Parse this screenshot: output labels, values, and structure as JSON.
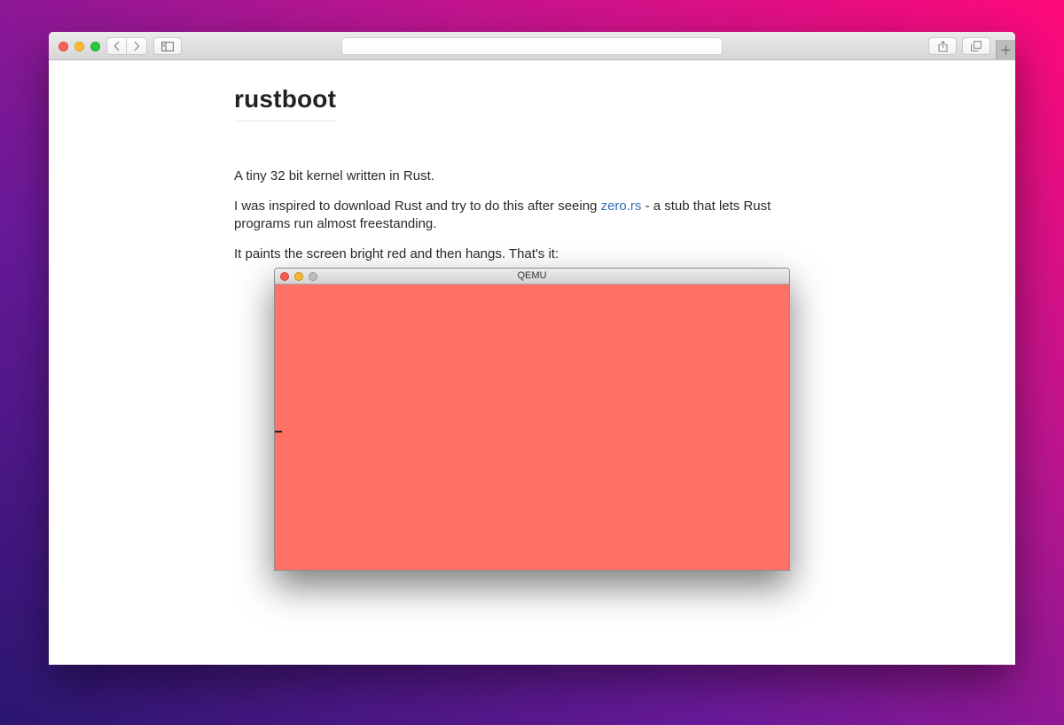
{
  "browser": {
    "address": ""
  },
  "page": {
    "title": "rustboot",
    "intro": "A tiny 32 bit kernel written in Rust.",
    "inspired_before": "I was inspired to download Rust and try to do this after seeing ",
    "inspired_link": "zero.rs",
    "inspired_after": " - a stub that lets Rust programs run almost freestanding.",
    "paints": "It paints the screen bright red and then hangs. That's it:"
  },
  "qemu": {
    "title": "QEMU"
  },
  "colors": {
    "link": "#2f6db5",
    "qemu_screen": "#ff7066",
    "text": "#2a2a2a"
  }
}
